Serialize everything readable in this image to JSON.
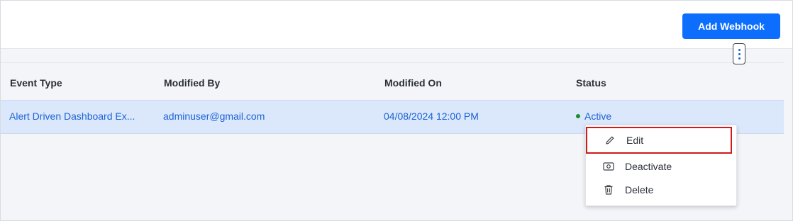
{
  "toolbar": {
    "add_webhook_label": "Add Webhook"
  },
  "table": {
    "columns": [
      "Event Type",
      "Modified By",
      "Modified On",
      "Status"
    ],
    "rows": [
      {
        "event_type": "Alert Driven Dashboard Ex...",
        "modified_by": "adminuser@gmail.com",
        "modified_on": "04/08/2024 12:00 PM",
        "status": "Active"
      }
    ]
  },
  "context_menu": {
    "items": [
      {
        "label": "Edit",
        "icon": "pencil-icon"
      },
      {
        "label": "Deactivate",
        "icon": "camera-icon"
      },
      {
        "label": "Delete",
        "icon": "trash-icon"
      }
    ]
  },
  "colors": {
    "primary": "#0d6efd",
    "link": "#1b63d6",
    "active_dot": "#1a8c2d",
    "selected_row": "#dbe7fb",
    "highlight_border": "#d11a1a"
  }
}
